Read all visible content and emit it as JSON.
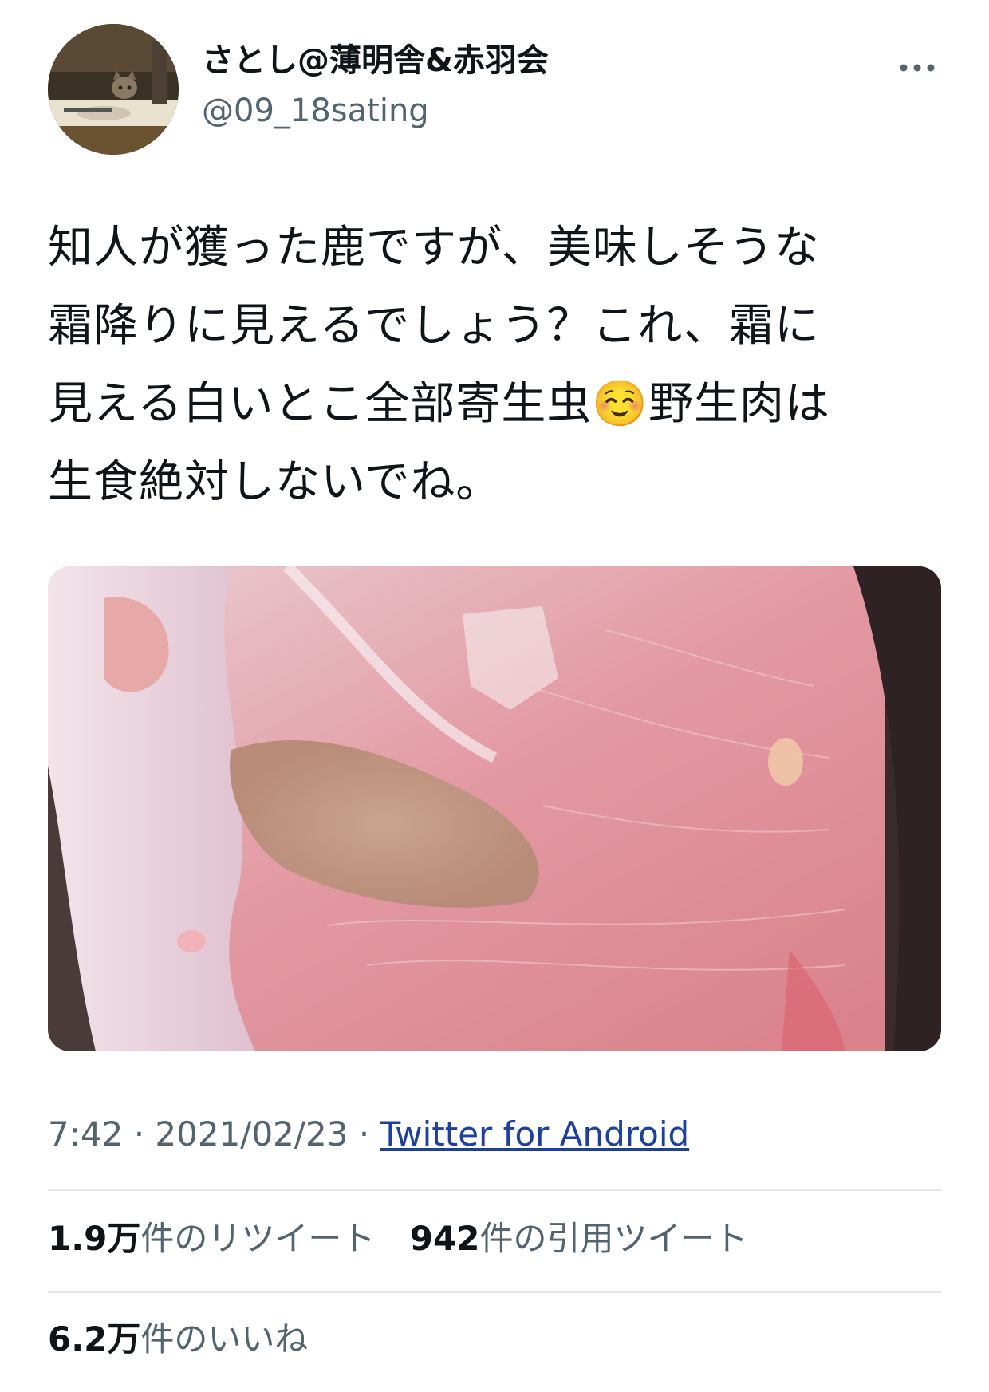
{
  "author": {
    "display_name": "さとし@薄明舎&赤羽会",
    "handle": "@09_18sating"
  },
  "tweet": {
    "text": "知人が獲った鹿ですが、美味しそうな\n霜降りに見えるでしょう？これ、霜に\n見える白いとこ全部寄生虫☺️野生肉は\n生食絶対しないでね。",
    "time": "7:42",
    "separator": "·",
    "date": "2021/02/23",
    "source": "Twitter for Android"
  },
  "stats": {
    "retweets_count": "1.9万",
    "retweets_label": "件のリツイート",
    "quotes_count": "942",
    "quotes_label": "件の引用ツイート",
    "likes_count": "6.2万",
    "likes_label": "件のいいね"
  },
  "icons": {
    "more": "more-horizontal-icon"
  },
  "colors": {
    "text": "#0f1419",
    "secondary": "#536471",
    "link": "#1d3fa0",
    "divider": "#e1e6ea"
  }
}
